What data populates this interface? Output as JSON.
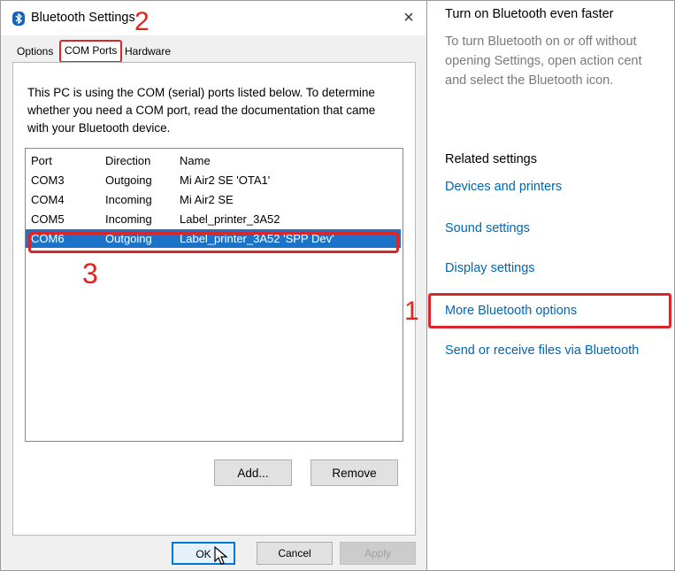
{
  "dialog": {
    "title": "Bluetooth Settings",
    "close_glyph": "×",
    "tabs": [
      "Options",
      "COM Ports",
      "Hardware"
    ],
    "description": "This PC is using the COM (serial) ports listed below. To determine whether you need a COM port, read the documentation that came with your Bluetooth device.",
    "columns": [
      "Port",
      "Direction",
      "Name"
    ],
    "rows": [
      {
        "port": "COM3",
        "direction": "Outgoing",
        "name": "Mi Air2 SE 'OTA1'"
      },
      {
        "port": "COM4",
        "direction": "Incoming",
        "name": "Mi Air2 SE"
      },
      {
        "port": "COM5",
        "direction": "Incoming",
        "name": "Label_printer_3A52"
      },
      {
        "port": "COM6",
        "direction": "Outgoing",
        "name": "Label_printer_3A52 'SPP Dev'"
      }
    ],
    "selected_row": "COM6",
    "add_label": "Add...",
    "remove_label": "Remove",
    "ok_label": "OK",
    "cancel_label": "Cancel",
    "apply_label": "Apply"
  },
  "annotations": {
    "one": "1",
    "two": "2",
    "three": "3"
  },
  "settings": {
    "title": "Turn on Bluetooth even faster",
    "desc_lines": [
      "To turn Bluetooth on or off without",
      "opening Settings, open action cent",
      "and select the Bluetooth icon."
    ],
    "related_heading": "Related settings",
    "links": {
      "devices": "Devices and printers",
      "sound": "Sound settings",
      "display": "Display settings",
      "more": "More Bluetooth options",
      "send": "Send or receive files via Bluetooth"
    }
  },
  "colors": {
    "annotation_red": "#d9262a",
    "selection_blue": "#1a73c8",
    "link_blue": "#0066b4"
  },
  "icons": {
    "title_icon": "bluetooth-icon",
    "close": "close-icon",
    "cursor": "mouse-pointer-icon"
  }
}
